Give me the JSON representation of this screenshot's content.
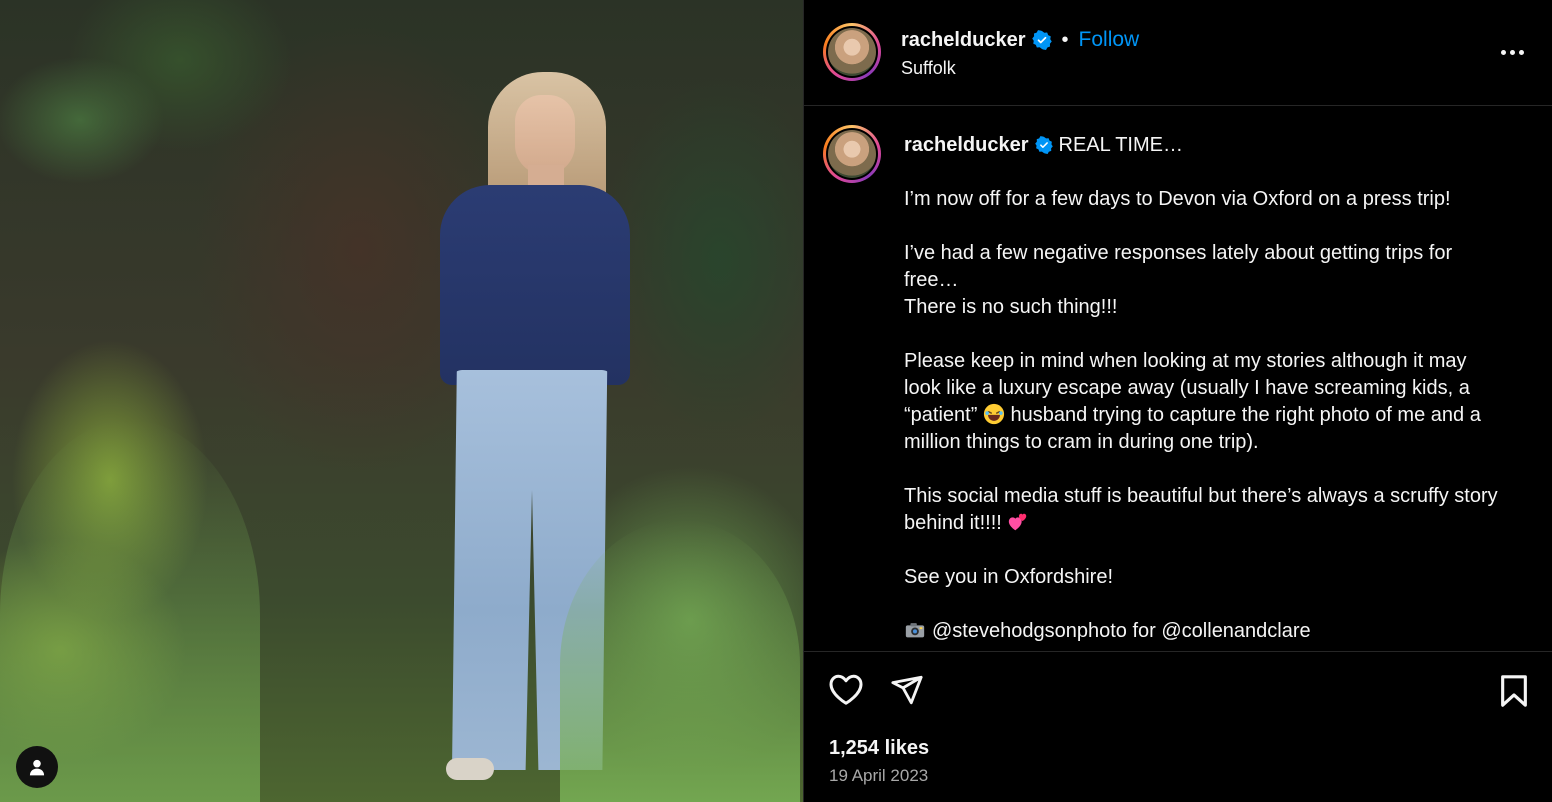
{
  "post": {
    "username": "rachelducker",
    "follow_label": "Follow",
    "separator": "•",
    "location": "Suffolk",
    "caption": {
      "username": "rachelducker",
      "title": "REAL TIME…",
      "para1": "I’m now off for a few days to Devon via Oxford on a press trip!",
      "para2_line1": "I’ve had a few negative responses lately about getting trips for free…",
      "para2_line2": "There is no such thing!!!",
      "para3_a": "Please keep in mind when looking at my stories although it may look like a luxury escape away (usually I have screaming kids, a “patient”",
      "para3_b": "husband trying to capture the right photo of me and a million things to cram in during one trip).",
      "para4": "This social media stuff is beautiful but there’s always a scruffy story behind it!!!!",
      "para5": "See you in Oxfordshire!",
      "credit_photographer": "@stevehodgsonphoto",
      "credit_for": "for",
      "credit_brand": "@collenandclare"
    },
    "likes": "1,254 likes",
    "date": "19 April 2023"
  },
  "icons": {
    "verified": "verified-badge-icon",
    "more": "more-options-icon",
    "like": "heart-icon",
    "share": "send-icon",
    "save": "bookmark-icon",
    "account": "person-icon",
    "emoji_laugh": "laughing-emoji",
    "emoji_hearts": "two-hearts-emoji",
    "emoji_camera": "camera-emoji"
  },
  "colors": {
    "follow": "#0095f6",
    "verified": "#0095f6",
    "background": "#000000",
    "secondary_text": "#a8a8a8"
  }
}
